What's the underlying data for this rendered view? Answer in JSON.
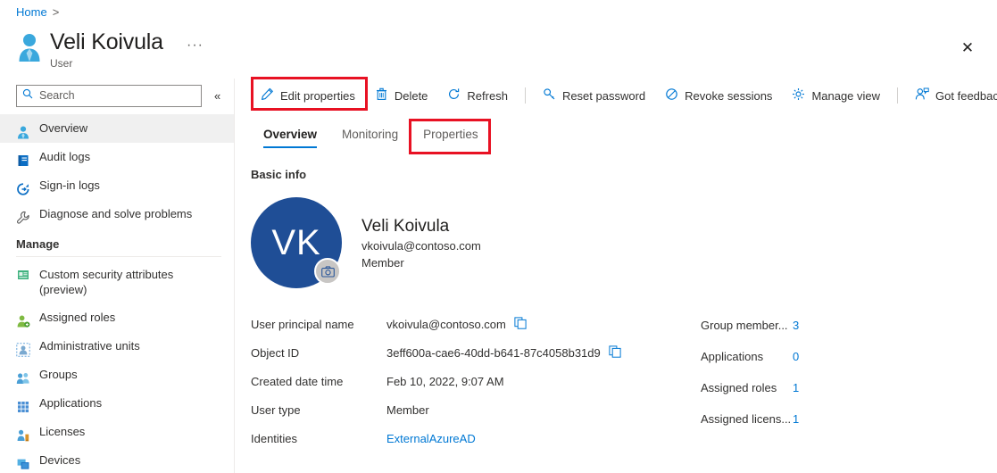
{
  "breadcrumb": {
    "home_label": "Home",
    "separator": ">"
  },
  "header": {
    "title": "Veli Koivula",
    "subtitle": "User",
    "ellipsis_label": "···",
    "close_label": "✕",
    "user_icon": "user-icon"
  },
  "sidebar": {
    "search": {
      "placeholder": "Search",
      "value": "",
      "icon": "search-icon"
    },
    "collapse_label": "«",
    "items": [
      {
        "label": "Overview",
        "icon": "user-overview-icon",
        "selected": true
      },
      {
        "label": "Audit logs",
        "icon": "audit-logs-icon",
        "selected": false
      },
      {
        "label": "Sign-in logs",
        "icon": "sign-in-logs-icon",
        "selected": false
      },
      {
        "label": "Diagnose and solve problems",
        "icon": "wrench-icon",
        "selected": false
      }
    ],
    "manage_group": {
      "header": "Manage",
      "items": [
        {
          "label": "Custom security attributes\n(preview)",
          "icon": "custom-security-attributes-icon",
          "two_line": true
        },
        {
          "label": "Assigned roles",
          "icon": "assigned-roles-icon",
          "two_line": false
        },
        {
          "label": "Administrative units",
          "icon": "administrative-units-icon",
          "two_line": false
        },
        {
          "label": "Groups",
          "icon": "groups-icon",
          "two_line": false
        },
        {
          "label": "Applications",
          "icon": "applications-icon",
          "two_line": false
        },
        {
          "label": "Licenses",
          "icon": "licenses-icon",
          "two_line": false
        },
        {
          "label": "Devices",
          "icon": "devices-icon",
          "two_line": false
        }
      ]
    }
  },
  "commandbar": {
    "buttons": [
      {
        "label": "Edit properties",
        "icon": "pencil-icon"
      },
      {
        "label": "Delete",
        "icon": "trash-icon"
      },
      {
        "label": "Refresh",
        "icon": "refresh-icon"
      },
      {
        "label": "Reset password",
        "icon": "key-icon"
      },
      {
        "label": "Revoke sessions",
        "icon": "block-icon"
      },
      {
        "label": "Manage view",
        "icon": "gear-icon"
      },
      {
        "label": "Got feedback?",
        "icon": "feedback-icon"
      }
    ]
  },
  "tabs": [
    {
      "label": "Overview",
      "active": true
    },
    {
      "label": "Monitoring",
      "active": false
    },
    {
      "label": "Properties",
      "active": false
    }
  ],
  "main": {
    "section_title": "Basic info",
    "profile": {
      "initials": "VK",
      "name": "Veli Koivula",
      "email": "vkoivula@contoso.com",
      "type": "Member",
      "camera_icon": "camera-icon"
    },
    "details_left": [
      {
        "key": "User principal name",
        "value": "vkoivula@contoso.com",
        "copy": true,
        "link": false
      },
      {
        "key": "Object ID",
        "value": "3eff600a-cae6-40dd-b641-87c4058b31d9",
        "copy": true,
        "link": false
      },
      {
        "key": "Created date time",
        "value": "Feb 10, 2022, 9:07 AM",
        "copy": false,
        "link": false
      },
      {
        "key": "User type",
        "value": "Member",
        "copy": false,
        "link": false
      },
      {
        "key": "Identities",
        "value": "ExternalAzureAD",
        "copy": false,
        "link": true
      }
    ],
    "details_right": [
      {
        "key": "Group member...",
        "value": "3"
      },
      {
        "key": "Applications",
        "value": "0"
      },
      {
        "key": "Assigned roles",
        "value": "1"
      },
      {
        "key": "Assigned licens...",
        "value": "1"
      }
    ]
  },
  "annotations": {
    "accent_color": "#e81123",
    "boxes": [
      {
        "name": "edit-properties-highlight",
        "target": "Edit properties"
      },
      {
        "name": "properties-tab-highlight",
        "target": "Properties"
      }
    ]
  },
  "colors": {
    "link": "#0078d4",
    "avatar": "#1f4e96",
    "annotation": "#e81123",
    "selected_nav": "#f0f0f0"
  }
}
